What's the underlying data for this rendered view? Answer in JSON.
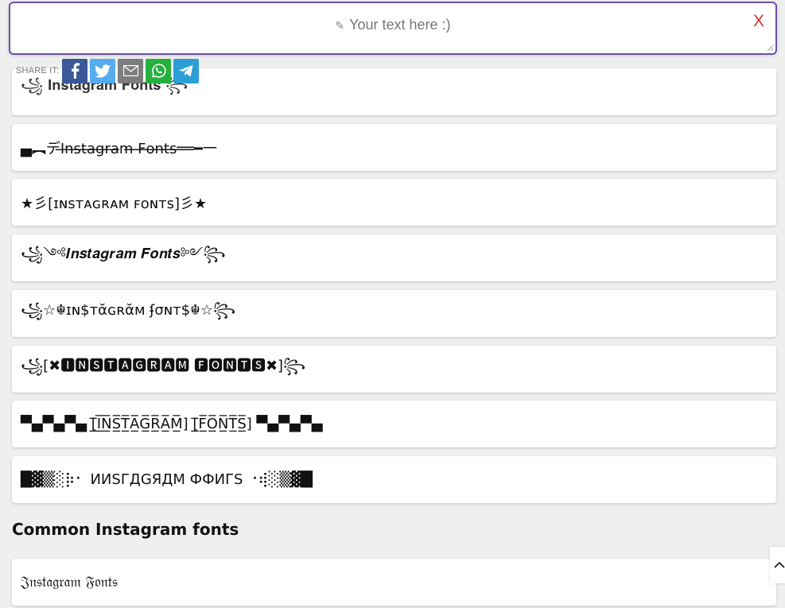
{
  "input": {
    "placeholder_icon": "pencil-icon",
    "placeholder": "Your text here :)",
    "clear_label": "X"
  },
  "share": {
    "label": "SHARE IT:",
    "buttons": [
      {
        "name": "facebook",
        "icon": "facebook-icon",
        "color": "#3b5998"
      },
      {
        "name": "twitter",
        "icon": "twitter-icon",
        "color": "#55acee"
      },
      {
        "name": "email",
        "icon": "email-icon",
        "color": "#7d7d7d"
      },
      {
        "name": "whatsapp",
        "icon": "whatsapp-icon",
        "color": "#25b03f"
      },
      {
        "name": "telegram",
        "icon": "telegram-icon",
        "color": "#2b9fd6"
      }
    ]
  },
  "fonts": [
    "꧁ 𝐈𝐧𝐬𝐭𝐚𝐠𝐫𝐚𝐦 𝐅𝐨𝐧𝐭𝐬 ꧂",
    "▄︻デI̶n̶s̶t̶a̶g̶r̶a̶m̶ ̶F̶o̶n̶t̶s̶══━一",
    "★彡[ɪɴꜱᴛᴀɢʀᴀᴍ ꜰᴏɴᴛꜱ]彡★",
    "꧁༺𝑰𝒏𝒔𝒕𝒂𝒈𝒓𝒂𝒎 𝑭𝒐𝒏𝒕𝒔༻꧂",
    "꧁☆☬ɪɴ$ᴛᾰɢʀᾰᴍ ʄσɴᴛ$☬☆꧂",
    "꧁[✖🅸🅽🆂🆃🅰🅶🆁🅰🅼 🅵🅾🅽🆃🆂✖]꧂",
    "▀▄▀▄▀▄ [̲̅I̲̅N̲̅S̲̅T̲̅A̲̅G̲̅R̲̅A̲̅M̲̅] [̲̅F̲̅O̲̅N̲̅T̲̅S̲̅] ▀▄▀▄▀▄",
    "█▓▒░⡷⠂ ИИSГДGЯДM ФФИГS ⠐⢾░▒▓█"
  ],
  "section_title": "Common Instagram fonts",
  "common_fonts": [
    "𝔍𝔫𝔰𝔱𝔞𝔤𝔯𝔞𝔪 𝔉𝔬𝔫𝔱𝔰"
  ],
  "back_to_top_icon": "chevron-up-icon"
}
